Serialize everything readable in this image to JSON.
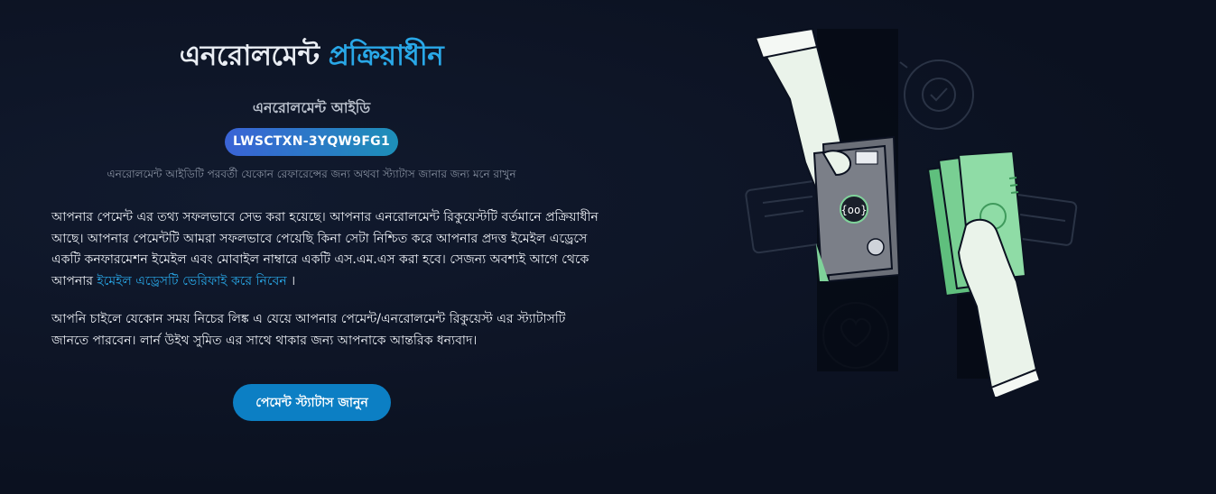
{
  "heading": {
    "part1": "এনরোলমেন্ট ",
    "part2": "প্রক্রিয়াধীন"
  },
  "enrollment": {
    "label": "এনরোলমেন্ট আইডি",
    "id": "LWSCTXN-3YQW9FG1",
    "hint": "এনরোলমেন্ট আইডিটি পরবর্তী যেকোন রেফারেন্সের জন্য অথবা স্ট্যাটাস জানার জন্য মনে রাখুন"
  },
  "paragraph1": {
    "text": "আপনার পেমেন্ট এর তথ্য সফলভাবে সেভ করা হয়েছে। আপনার এনরোলমেন্ট রিকুয়েস্টটি বর্তমানে প্রক্রিয়াধীন আছে। আপনার পেমেন্টটি আমরা সফলভাবে পেয়েছি কিনা সেটা নিশ্চিত করে আপনার প্রদত্ত ইমেইল এড্রেসে একটি কনফারমেশন ইমেইল এবং মোবাইল নাম্বারে একটি এস.এম.এস করা হবে। সেজন্য অবশ্যই আগে থেকে আপনার ",
    "link": "ইমেইল এড্রেসটি ভেরিফাই করে নিবেন",
    "suffix": " ।"
  },
  "paragraph2": {
    "text": "আপনি চাইলে যেকোন সময় নিচের লিঙ্ক এ যেয়ে আপনার পেমেন্ট/এনরোলমেন্ট রিকুয়েস্ট এর স্ট্যাটাসটি জানতে পারবেন। লার্ন উইথ সুমিত এর সাথে থাকার জন্য আপনাকে আন্তরিক ধন্যবাদ।"
  },
  "cta": {
    "label": "পেমেন্ট স্ট্যাটাস জানুন"
  },
  "illustration": {
    "name": "payment-handover-illustration",
    "icons": [
      "check-circle-icon",
      "heart-bubble-icon",
      "wallet-icon",
      "cash-icon",
      "document-icon",
      "card-icon"
    ]
  },
  "colors": {
    "background": "#0b1120",
    "accent": "#29a8e8",
    "button": "#0c7fc4",
    "badge_start": "#3a63d6",
    "badge_end": "#1d8fb8",
    "cash_green": "#7fd39a"
  }
}
